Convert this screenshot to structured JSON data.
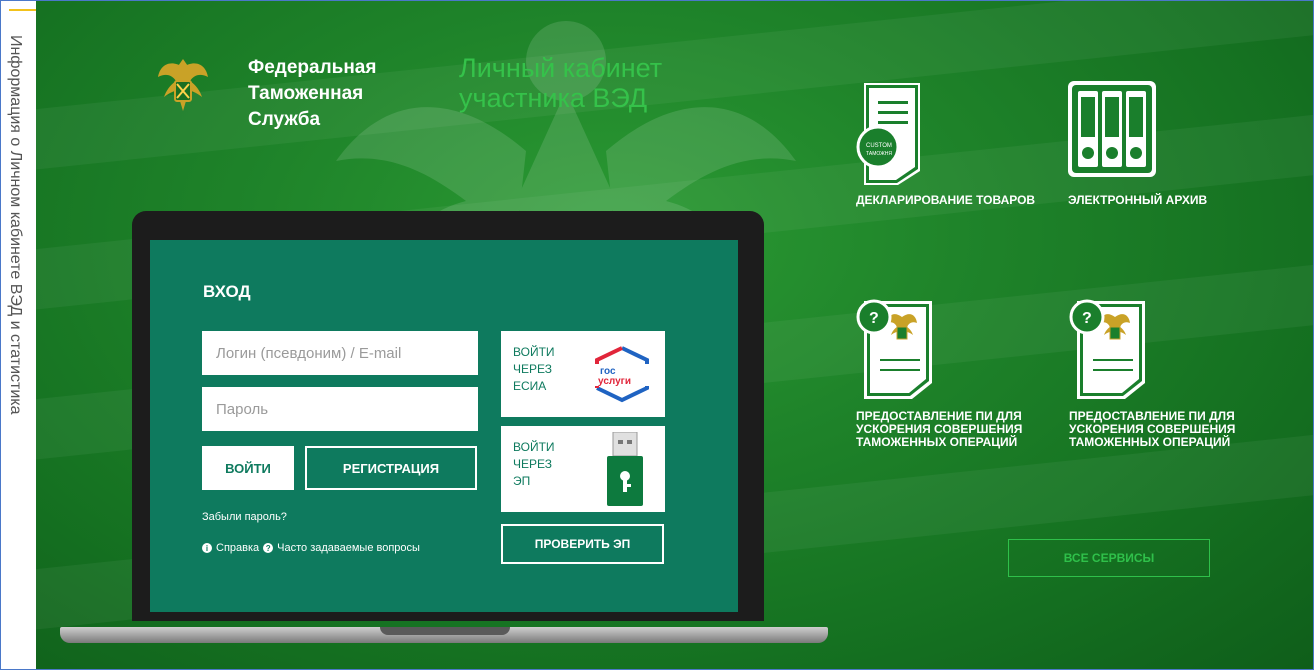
{
  "side_tab": {
    "text": "Информация о Личном кабинете ВЭД и статистика"
  },
  "header": {
    "org_line1": "Федеральная",
    "org_line2": "Таможенная",
    "org_line3": "Служба",
    "cabinet_line1": "Личный кабинет",
    "cabinet_line2": "участника ВЭД"
  },
  "login": {
    "title": "ВХОД",
    "login_placeholder": "Логин (псевдоним) / E-mail",
    "password_placeholder": "Пароль",
    "login_button": "ВОЙТИ",
    "register_button": "РЕГИСТРАЦИЯ",
    "forgot_password": "Забыли пароль?",
    "help": "Справка",
    "faq": "Часто задаваемые вопросы"
  },
  "auth": {
    "esia_line1": "ВОЙТИ",
    "esia_line2": "ЧЕРЕЗ",
    "esia_line3": "ЕСИА",
    "gos_logo_top": "гос",
    "gos_logo_bottom": "услуги",
    "ep_line1": "ВОЙТИ",
    "ep_line2": "ЧЕРЕЗ",
    "ep_line3": "ЭП",
    "check_ep": "ПРОВЕРИТЬ ЭП"
  },
  "services": [
    {
      "label": "ДЕКЛАРИРОВАНИЕ ТОВАРОВ",
      "icon": "declaration-icon"
    },
    {
      "label": "ЭЛЕКТРОННЫЙ АРХИВ",
      "icon": "archive-binders-icon"
    },
    {
      "label": "ПРЕДОСТАВЛЕНИЕ ПИ ДЛЯ УСКОРЕНИЯ СОВЕРШЕНИЯ ТАМОЖЕННЫХ ОПЕРАЦИЙ",
      "icon": "pi-document-icon"
    },
    {
      "label": "ПРЕДОСТАВЛЕНИЕ ПИ ДЛЯ УСКОРЕНИЯ СОВЕРШЕНИЯ ТАМОЖЕННЫХ ОПЕРАЦИЙ",
      "icon": "pi-document-icon"
    }
  ],
  "all_services": "ВСЕ СЕРВИСЫ",
  "colors": {
    "primary_green": "#157121",
    "screen_teal": "#0e7a5e",
    "accent_green": "#35c24a",
    "gosuslugi_blue": "#1f63c2",
    "gosuslugi_red": "#e1253a"
  }
}
